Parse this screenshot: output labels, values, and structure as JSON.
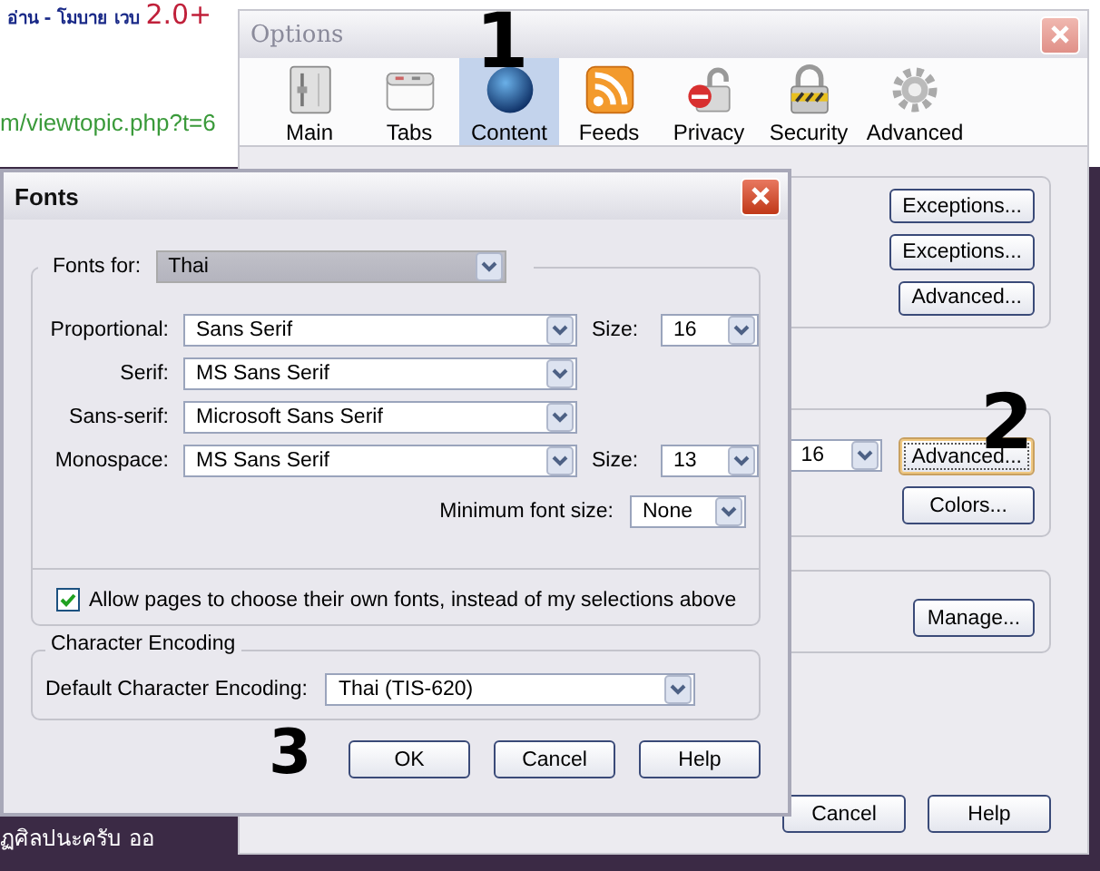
{
  "background": {
    "headline": "อ่าน - โมบาย เวบ",
    "headline_version": "2.0+",
    "link": "m/viewtopic.php?t=6",
    "footer_text": "ฏศิลปนะครับ ออ"
  },
  "options": {
    "title": "Options",
    "tabs": [
      {
        "label": "Main",
        "kind": "main",
        "selected": false
      },
      {
        "label": "Tabs",
        "kind": "tabs",
        "selected": false
      },
      {
        "label": "Content",
        "kind": "content",
        "selected": true
      },
      {
        "label": "Feeds",
        "kind": "feeds",
        "selected": false
      },
      {
        "label": "Privacy",
        "kind": "privacy",
        "selected": false
      },
      {
        "label": "Security",
        "kind": "security",
        "selected": false
      },
      {
        "label": "Advanced",
        "kind": "advanced",
        "selected": false
      }
    ],
    "groups": [
      {
        "kind": "buttons",
        "buttons": [
          {
            "label": "Exceptions...",
            "focused": false
          },
          {
            "label": "Exceptions...",
            "focused": false
          },
          {
            "label": "Advanced...",
            "focused": false
          }
        ]
      },
      {
        "kind": "size",
        "size": "16",
        "buttons": [
          {
            "label": "Advanced...",
            "focused": true
          },
          {
            "label": "Colors...",
            "focused": false
          }
        ]
      },
      {
        "kind": "buttons",
        "buttons": [
          {
            "label": "Manage...",
            "focused": false
          }
        ]
      }
    ],
    "footer_buttons": [
      "Cancel",
      "Help"
    ]
  },
  "fonts": {
    "title": "Fonts",
    "fonts_for_label": "Fonts for:",
    "fonts_for": "Thai",
    "rows": [
      {
        "label": "Proportional:",
        "value": "Sans Serif",
        "size_label": "Size:",
        "size": "16"
      },
      {
        "label": "Serif:",
        "value": "MS Sans Serif"
      },
      {
        "label": "Sans-serif:",
        "value": "Microsoft Sans Serif"
      },
      {
        "label": "Monospace:",
        "value": "MS Sans Serif",
        "size_label": "Size:",
        "size": "13"
      }
    ],
    "min_size_label": "Minimum font size:",
    "min_size": "None",
    "allow": {
      "label": "Allow pages to choose their own fonts, instead of my selections above",
      "checked": true
    },
    "encoding": {
      "legend": "Character Encoding",
      "label": "Default Character Encoding:",
      "value": "Thai (TIS-620)"
    },
    "buttons": [
      "OK",
      "Cancel",
      "Help"
    ]
  },
  "annotations": [
    "1",
    "2",
    "3"
  ]
}
